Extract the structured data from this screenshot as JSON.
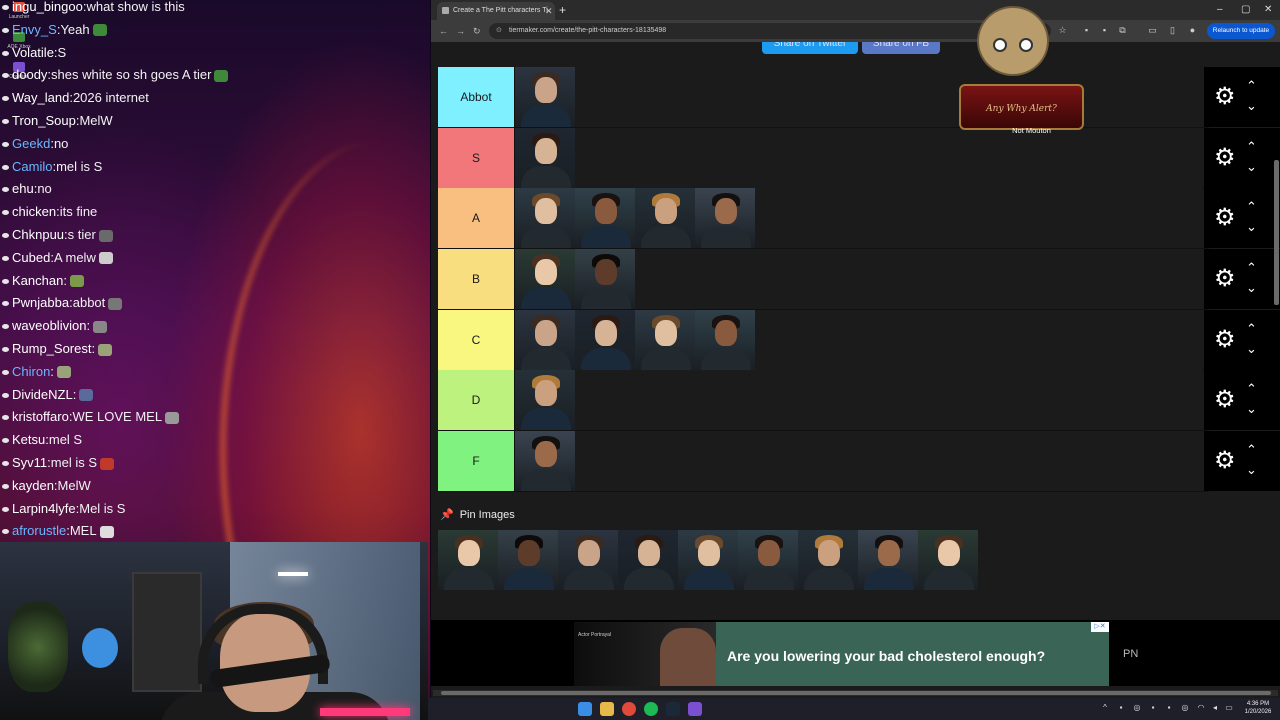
{
  "chat": [
    {
      "user": "ingu_bingoo",
      "text": "what show is this",
      "color": "white",
      "emote": ""
    },
    {
      "user": "Envy_S",
      "text": "Yeah",
      "color": "blue",
      "emote": "#3f8a3a"
    },
    {
      "user": "Volatile",
      "text": "S",
      "color": "white",
      "emote": ""
    },
    {
      "user": "doody",
      "text": "shes white so sh goes A tier",
      "color": "white",
      "emote": "#3f8a3a"
    },
    {
      "user": "Way_land",
      "text": "2026 internet",
      "color": "white",
      "emote": ""
    },
    {
      "user": "Tron_Soup",
      "text": "MelW",
      "color": "white",
      "emote": ""
    },
    {
      "user": "Geekd",
      "text": "no",
      "color": "blue",
      "emote": ""
    },
    {
      "user": "Camilo",
      "text": "mel is S",
      "color": "blue",
      "emote": ""
    },
    {
      "user": "ehu",
      "text": "no",
      "color": "white",
      "emote": ""
    },
    {
      "user": "chicken",
      "text": "its fine",
      "color": "white",
      "emote": ""
    },
    {
      "user": "Chknpuu",
      "text": "s tier",
      "color": "white",
      "emote": "#6a6a6a"
    },
    {
      "user": "Cubed",
      "text": "A melw",
      "color": "white",
      "emote": "#cccccc"
    },
    {
      "user": "Kanchan",
      "text": "",
      "color": "white",
      "emote": "#7c9a4a"
    },
    {
      "user": "Pwnjabba",
      "text": "abbot",
      "color": "white",
      "emote": "#777777"
    },
    {
      "user": "waveoblivion",
      "text": "",
      "color": "white",
      "emote": "#888888"
    },
    {
      "user": "Rump_Sorest",
      "text": "",
      "color": "white",
      "emote": "#9aa27a"
    },
    {
      "user": "Chiron",
      "text": "",
      "color": "blue",
      "emote": "#9aa27a"
    },
    {
      "user": "DivideNZL",
      "text": "",
      "color": "white",
      "emote": "#5a6a9a"
    },
    {
      "user": "kristoffaro",
      "text": "WE LOVE MEL",
      "color": "white",
      "emote": "#999999"
    },
    {
      "user": "Ketsu",
      "text": "mel S",
      "color": "white",
      "emote": ""
    },
    {
      "user": "Syv11",
      "text": "mel is S",
      "color": "white",
      "emote": "#c0392b"
    },
    {
      "user": "kayden",
      "text": "MelW",
      "color": "white",
      "emote": ""
    },
    {
      "user": "Larpin4lyfe",
      "text": "Mel is S",
      "color": "white",
      "emote": ""
    },
    {
      "user": "afrorustle",
      "text": "MEL",
      "color": "blue",
      "emote": "#dddddd"
    }
  ],
  "desktop_icons": [
    "Launcher",
    "AOE Xbox",
    "Obsidian"
  ],
  "browser": {
    "tab_title": "Create a The Pitt characters Ti",
    "url": "tiermaker.com/create/the-pitt-characters-18135498",
    "relaunch_label": "Relaunch to update",
    "share_twitter": "Share on Twitter",
    "share_fb": "Share on FB"
  },
  "tiers": [
    {
      "label": "Abbot",
      "color": "#7ff0ff",
      "items": 1
    },
    {
      "label": "S",
      "color": "#f2777a",
      "items": 1
    },
    {
      "label": "A",
      "color": "#f9bf80",
      "items": 4
    },
    {
      "label": "B",
      "color": "#f9de80",
      "items": 2
    },
    {
      "label": "C",
      "color": "#f9f780",
      "items": 4
    },
    {
      "label": "D",
      "color": "#bef27f",
      "items": 1
    },
    {
      "label": "F",
      "color": "#7ff27f",
      "items": 1
    }
  ],
  "overlay": {
    "podium_text": "Any Why Alert?",
    "caption": "Not Mouton"
  },
  "pin_images": {
    "label": "Pin Images",
    "count": 9
  },
  "ad": {
    "actor_text": "Actor Portrayal",
    "headline": "Are you lowering your bad cholesterol enough?",
    "brand": "PN"
  },
  "clock": {
    "time": "4:36 PM",
    "date": "1/20/2026"
  },
  "colors": {
    "accent_blue": "#0b57d0",
    "twitter_btn": "#1d9bf0",
    "fb_btn": "#5b78c7",
    "pin_accent": "#e03a7c"
  }
}
